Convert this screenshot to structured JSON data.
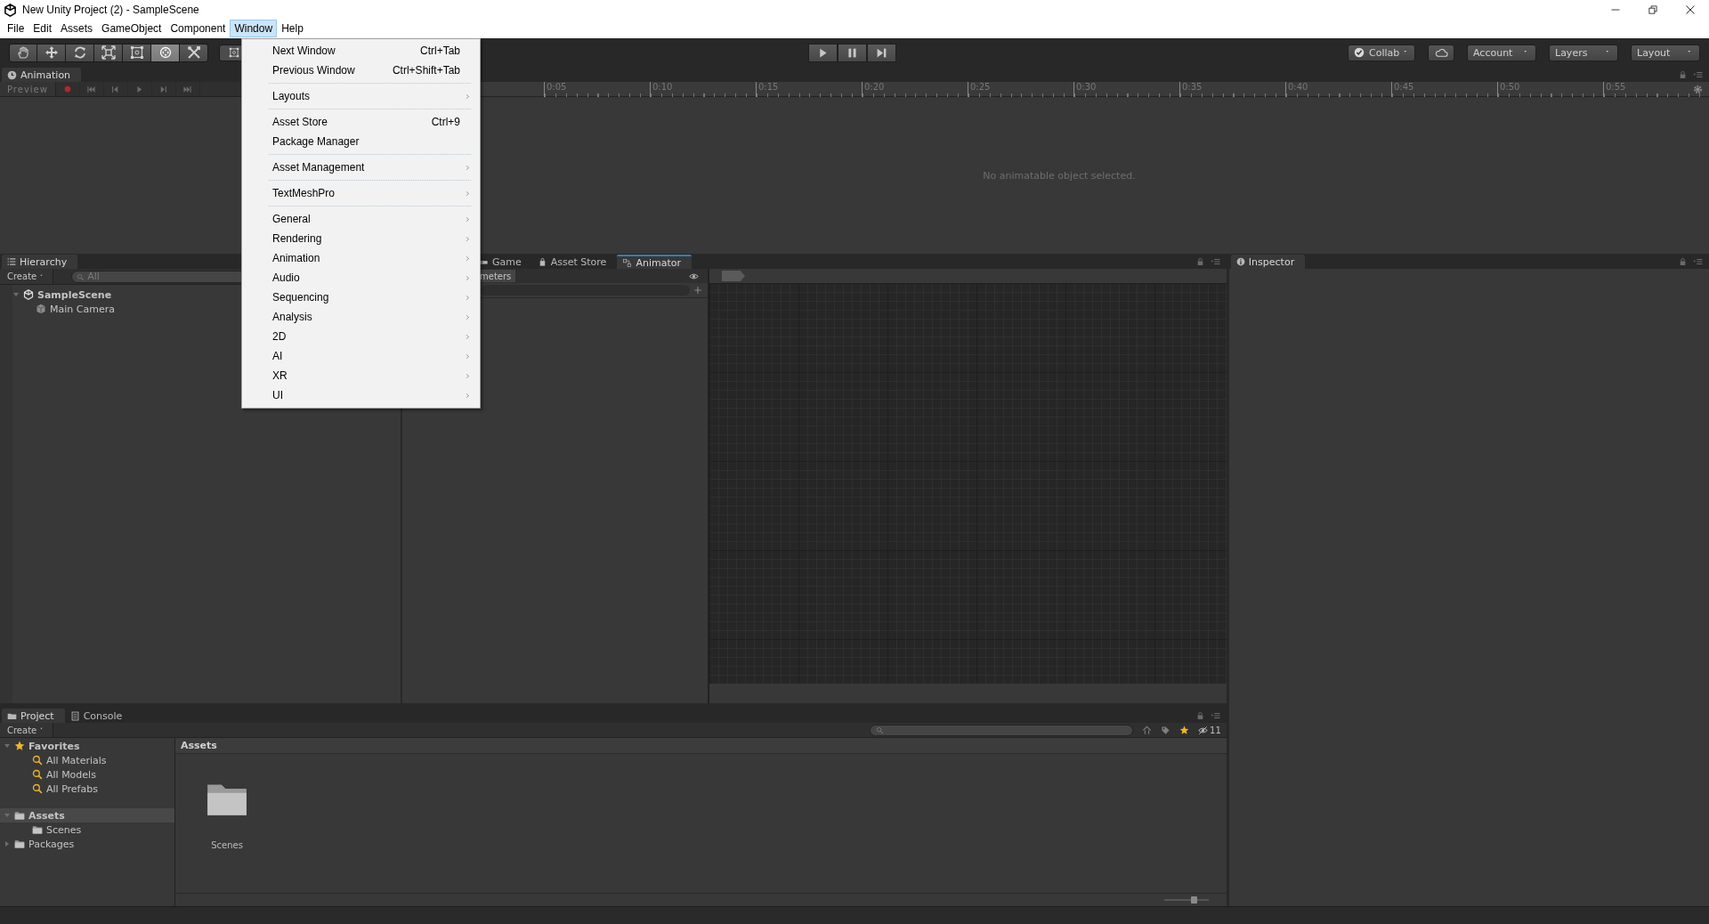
{
  "window": {
    "title": "New Unity Project (2) - SampleScene"
  },
  "menu_bar": [
    {
      "label": "File",
      "selected": false
    },
    {
      "label": "Edit",
      "selected": false
    },
    {
      "label": "Assets",
      "selected": false
    },
    {
      "label": "GameObject",
      "selected": false
    },
    {
      "label": "Component",
      "selected": false
    },
    {
      "label": "Window",
      "selected": true
    },
    {
      "label": "Help",
      "selected": false
    }
  ],
  "open_menu": {
    "items": [
      {
        "kind": "item",
        "label": "Next Window",
        "shortcut": "Ctrl+Tab",
        "submenu": false
      },
      {
        "kind": "item",
        "label": "Previous Window",
        "shortcut": "Ctrl+Shift+Tab",
        "submenu": false
      },
      {
        "kind": "separator"
      },
      {
        "kind": "item",
        "label": "Layouts",
        "submenu": true
      },
      {
        "kind": "separator"
      },
      {
        "kind": "item",
        "label": "Asset Store",
        "shortcut": "Ctrl+9",
        "submenu": false
      },
      {
        "kind": "item",
        "label": "Package Manager",
        "submenu": false
      },
      {
        "kind": "separator"
      },
      {
        "kind": "item",
        "label": "Asset Management",
        "submenu": true
      },
      {
        "kind": "separator"
      },
      {
        "kind": "item",
        "label": "TextMeshPro",
        "submenu": true
      },
      {
        "kind": "separator"
      },
      {
        "kind": "item",
        "label": "General",
        "submenu": true
      },
      {
        "kind": "item",
        "label": "Rendering",
        "submenu": true
      },
      {
        "kind": "item",
        "label": "Animation",
        "submenu": true
      },
      {
        "kind": "item",
        "label": "Audio",
        "submenu": true
      },
      {
        "kind": "item",
        "label": "Sequencing",
        "submenu": true
      },
      {
        "kind": "item",
        "label": "Analysis",
        "submenu": true
      },
      {
        "kind": "item",
        "label": "2D",
        "submenu": true
      },
      {
        "kind": "item",
        "label": "AI",
        "submenu": true
      },
      {
        "kind": "item",
        "label": "XR",
        "submenu": true
      },
      {
        "kind": "item",
        "label": "UI",
        "submenu": true
      }
    ]
  },
  "toolbar": {
    "tools": [
      {
        "kind": "hand",
        "selected": false
      },
      {
        "kind": "move",
        "selected": false
      },
      {
        "kind": "rotate",
        "selected": false
      },
      {
        "kind": "scale",
        "selected": false
      },
      {
        "kind": "rect",
        "selected": false
      },
      {
        "kind": "transform",
        "selected": true
      },
      {
        "kind": "custom",
        "selected": false
      }
    ],
    "buttons": [
      {
        "kind": "collab",
        "label": "Collab"
      },
      {
        "kind": "cloud"
      },
      {
        "kind": "dropdown",
        "label": "Account"
      },
      {
        "kind": "dropdown",
        "label": "Layers"
      },
      {
        "kind": "dropdown",
        "label": "Layout"
      }
    ]
  },
  "animation": {
    "tab": "Animation",
    "preview": "Preview",
    "ruler_labels": [
      "0:05",
      "0:10",
      "0:15",
      "0:20",
      "0:25",
      "0:30",
      "0:35",
      "0:40",
      "0:45",
      "0:50",
      "0:55"
    ],
    "message": "No animatable object selected."
  },
  "hierarchy": {
    "tab": "Hierarchy",
    "create": "Create",
    "search_placeholder": "All",
    "tree": [
      {
        "label": "SampleScene",
        "kind": "scene",
        "expanded": true,
        "selected": false,
        "children": [
          {
            "label": "Main Camera",
            "kind": "object",
            "selected": false
          }
        ]
      }
    ]
  },
  "center": {
    "tabs": [
      {
        "label": "Game",
        "kind": "game",
        "selected": false
      },
      {
        "label": "Asset Store",
        "kind": "store",
        "selected": false
      },
      {
        "label": "Animator",
        "kind": "animator",
        "selected": true
      }
    ],
    "parameters_tab": "meters"
  },
  "inspector": {
    "tab": "Inspector"
  },
  "project": {
    "tabs": [
      {
        "label": "Project",
        "kind": "project",
        "selected": true
      },
      {
        "label": "Console",
        "kind": "console",
        "selected": false
      }
    ],
    "create": "Create",
    "count": "11",
    "tree": [
      {
        "label": "Favorites",
        "kind": "favorites",
        "expanded": true,
        "selected": false,
        "children": [
          {
            "label": "All Materials",
            "kind": "search",
            "selected": false
          },
          {
            "label": "All Models",
            "kind": "search",
            "selected": false
          },
          {
            "label": "All Prefabs",
            "kind": "search",
            "selected": false
          }
        ]
      },
      {
        "label": "Assets",
        "kind": "folder",
        "expanded": true,
        "selected": true,
        "children": [
          {
            "label": "Scenes",
            "kind": "folder",
            "selected": false
          }
        ]
      },
      {
        "label": "Packages",
        "kind": "folder",
        "expanded": false,
        "selected": false
      }
    ],
    "breadcrumb": "Assets",
    "zoom_slider": {
      "level": 0.7
    },
    "assets": [
      {
        "label": "Scenes",
        "kind": "folder"
      }
    ]
  }
}
